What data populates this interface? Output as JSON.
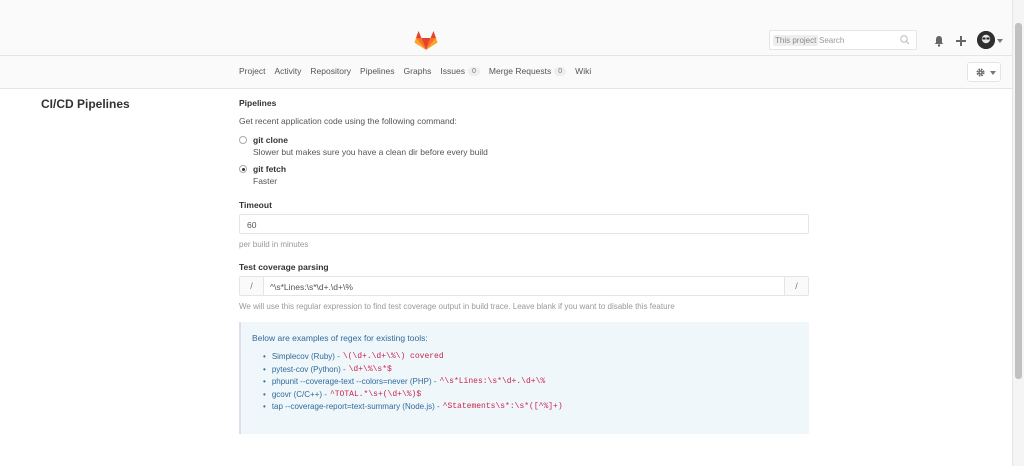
{
  "header": {
    "search": {
      "scope_label": "This project",
      "placeholder": "Search"
    },
    "colors": {
      "brand_orange": "#e24329",
      "accent_blue": "#2f6a9b"
    }
  },
  "nav": {
    "items": [
      {
        "label": "Project"
      },
      {
        "label": "Activity"
      },
      {
        "label": "Repository"
      },
      {
        "label": "Pipelines"
      },
      {
        "label": "Graphs"
      },
      {
        "label": "Issues",
        "count": "0"
      },
      {
        "label": "Merge Requests",
        "count": "0"
      },
      {
        "label": "Wiki"
      }
    ]
  },
  "sidebar": {
    "title": "CI/CD Pipelines"
  },
  "pipelines": {
    "heading": "Pipelines",
    "description": "Get recent application code using the following command:",
    "options": [
      {
        "label": "git clone",
        "help": "Slower but makes sure you have a clean dir before every build",
        "checked": false
      },
      {
        "label": "git fetch",
        "help": "Faster",
        "checked": true
      }
    ]
  },
  "timeout": {
    "heading": "Timeout",
    "value": "60",
    "help": "per build in minutes"
  },
  "coverage": {
    "heading": "Test coverage parsing",
    "prefix": "/",
    "suffix": "/",
    "value": "^\\s*Lines:\\s*\\d+.\\d+\\%",
    "help": "We will use this regular expression to find test coverage output in build trace. Leave blank if you want to disable this feature"
  },
  "examples": {
    "title": "Below are examples of regex for existing tools:",
    "items": [
      {
        "tool": "Simplecov (Ruby) -",
        "regex": "\\(\\d+.\\d+\\%\\) covered"
      },
      {
        "tool": "pytest-cov (Python) -",
        "regex": "\\d+\\%\\s*$"
      },
      {
        "tool": "phpunit --coverage-text --colors=never (PHP) -",
        "regex": "^\\s*Lines:\\s*\\d+.\\d+\\%"
      },
      {
        "tool": "gcovr (C/C++) -",
        "regex": "^TOTAL.*\\s+(\\d+\\%)$"
      },
      {
        "tool": "tap --coverage-report=text-summary (Node.js) -",
        "regex": "^Statements\\s*:\\s*([^%]+)"
      }
    ]
  }
}
